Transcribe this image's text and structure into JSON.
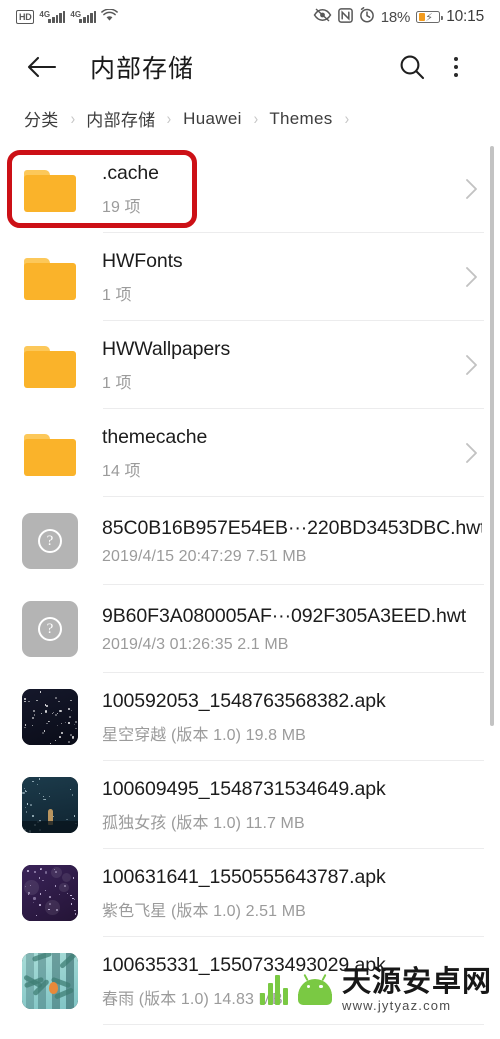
{
  "status_bar": {
    "hd_label": "HD",
    "network_label_1": "4G",
    "network_label_2": "4G",
    "wifi_icon": "wifi-icon",
    "eye_comfort_icon": "eye-comfort-icon",
    "nfc_icon": "nfc-icon",
    "alarm_icon": "alarm-icon",
    "battery_percent": "18%",
    "battery_icon": "battery-charging-icon",
    "time": "10:15"
  },
  "app_bar": {
    "back_icon": "back-arrow-icon",
    "title": "内部存储",
    "search_icon": "search-icon",
    "more_icon": "more-vertical-icon"
  },
  "breadcrumb": {
    "items": [
      "分类",
      "内部存储",
      "Huawei",
      "Themes"
    ],
    "separator": "›",
    "trailing_separator": "›"
  },
  "annotation": {
    "type": "red-highlight-box",
    "target": "list-item-cache",
    "color": "#cc1016"
  },
  "list": {
    "items": [
      {
        "name": ".cache",
        "sub": "19 项",
        "icon": "folder-icon",
        "kind": "folder",
        "has_chevron": true,
        "highlighted": true
      },
      {
        "name": "HWFonts",
        "sub": "1 项",
        "icon": "folder-icon",
        "kind": "folder",
        "has_chevron": true,
        "highlighted": false
      },
      {
        "name": "HWWallpapers",
        "sub": "1 项",
        "icon": "folder-icon",
        "kind": "folder",
        "has_chevron": true,
        "highlighted": false
      },
      {
        "name": "themecache",
        "sub": "14 项",
        "icon": "folder-icon",
        "kind": "folder",
        "has_chevron": true,
        "highlighted": false
      },
      {
        "name": "85C0B16B957E54EB···220BD3453DBC.hwt",
        "sub": "2019/4/15 20:47:29 7.51 MB",
        "icon": "unknown-file-icon",
        "kind": "unknown",
        "has_chevron": false,
        "highlighted": false
      },
      {
        "name": "9B60F3A080005AF···092F305A3EED.hwt",
        "sub": "2019/4/3 01:26:35 2.1 MB",
        "icon": "unknown-file-icon",
        "kind": "unknown",
        "has_chevron": false,
        "highlighted": false
      },
      {
        "name": "100592053_1548763568382.apk",
        "sub": "星空穿越 (版本 1.0) 19.8 MB",
        "icon": "apk-thumbnail-icon",
        "kind": "apk",
        "art": "starfield-dark-navy",
        "has_chevron": false,
        "highlighted": false
      },
      {
        "name": "100609495_1548731534649.apk",
        "sub": "孤独女孩 (版本 1.0) 11.7 MB",
        "icon": "apk-thumbnail-icon",
        "kind": "apk",
        "art": "night-teal-figure",
        "has_chevron": false,
        "highlighted": false
      },
      {
        "name": "100631641_1550555643787.apk",
        "sub": "紫色飞星 (版本 1.0) 2.51 MB",
        "icon": "apk-thumbnail-icon",
        "kind": "apk",
        "art": "starfield-purple",
        "has_chevron": false,
        "highlighted": false
      },
      {
        "name": "100635331_1550733493029.apk",
        "sub": "春雨 (版本 1.0) 14.83 MB",
        "icon": "apk-thumbnail-icon",
        "kind": "apk",
        "art": "spring-forest-teal",
        "has_chevron": false,
        "highlighted": false
      }
    ]
  },
  "watermark": {
    "title": "天源安卓网",
    "url": "www.jytyaz.com",
    "logo": "android-robot-icon",
    "color": "#7ac943"
  },
  "colors": {
    "folder": "#fab32a",
    "folder_tab": "#fcc85a",
    "unknown_file": "#b4b4b4",
    "accent_red": "#cc1016",
    "battery_orange": "#f29b1e"
  }
}
